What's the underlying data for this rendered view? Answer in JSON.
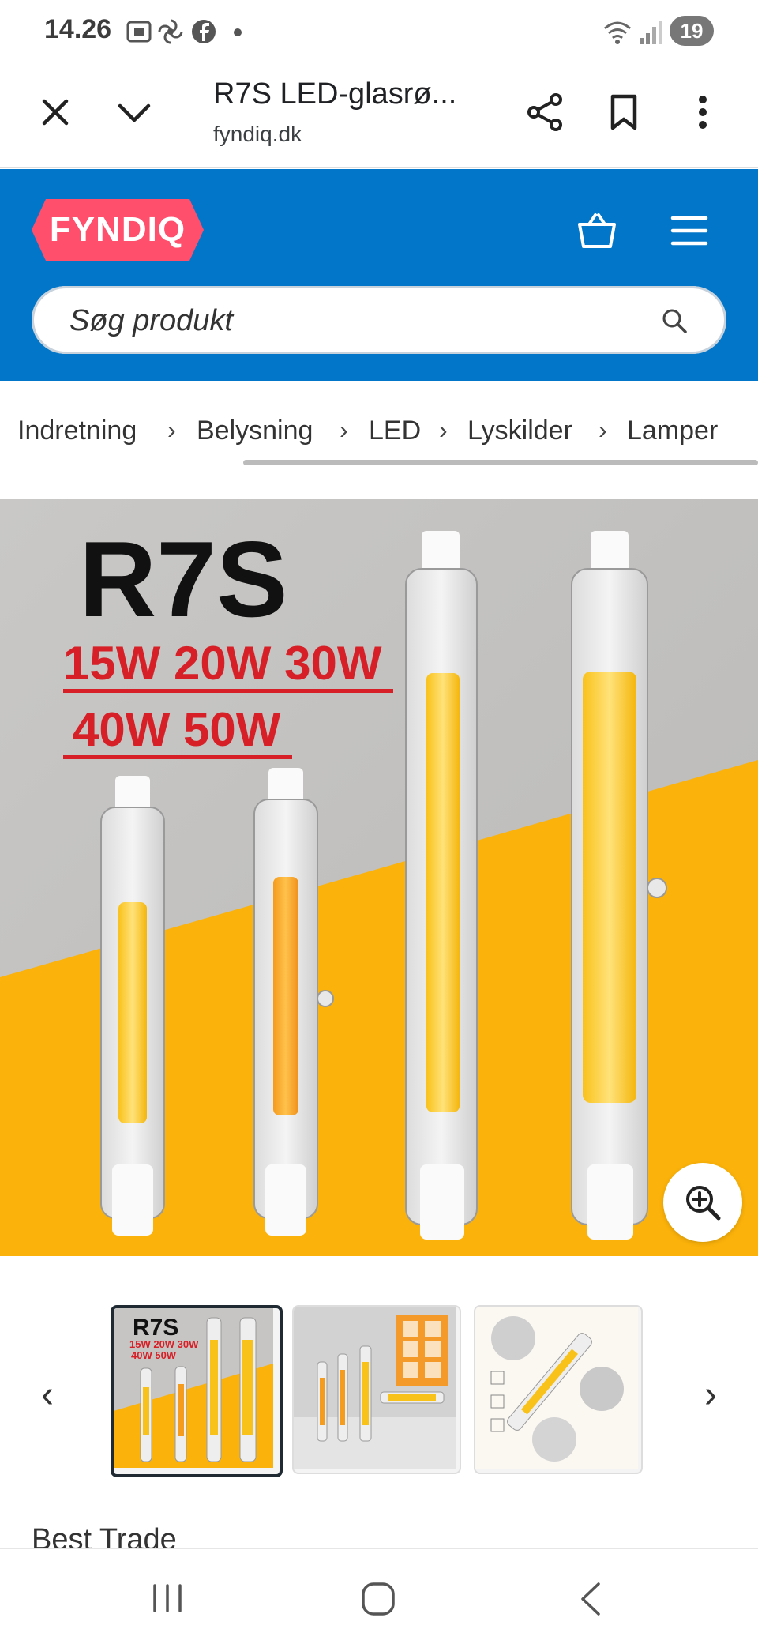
{
  "status_bar": {
    "time": "14.26",
    "battery": "19"
  },
  "browser": {
    "page_title": "R7S LED-glasrø...",
    "domain": "fyndiq.dk"
  },
  "site": {
    "logo_text": "FYNDIQ",
    "brand_color": "#0277c9",
    "logo_color": "#ff4f6d",
    "search_placeholder": "Søg produkt"
  },
  "breadcrumbs": [
    "Indretning",
    "Belysning",
    "LED",
    "Lyskilder",
    "Lamper"
  ],
  "product_image": {
    "headline": "R7S",
    "wattages_line1": "15W 20W 30W",
    "wattages_line2": "40W 50W"
  },
  "thumbnails": [
    {
      "label": "R7S",
      "sub1": "15W 20W 30W",
      "sub2": "40W 50W",
      "active": true
    },
    {
      "label": "",
      "active": false
    },
    {
      "label": "",
      "active": false
    }
  ],
  "seller_name": "Best Trade"
}
